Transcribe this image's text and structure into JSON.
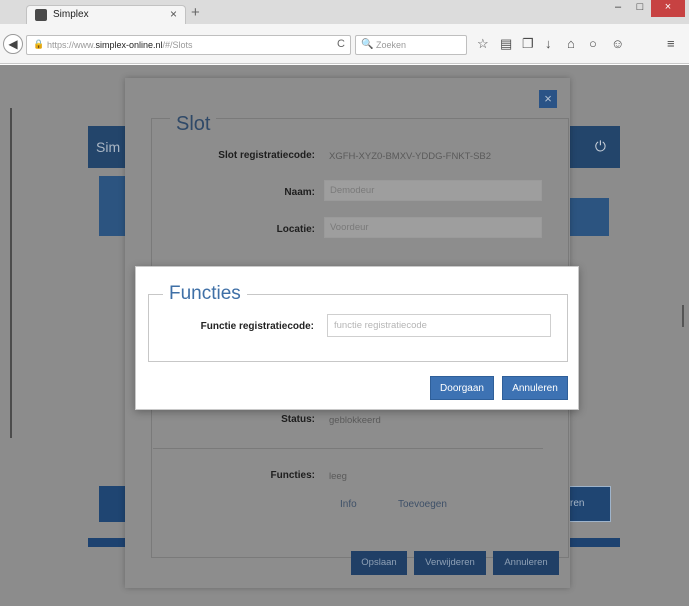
{
  "browser": {
    "tab_title": "Simplex",
    "tab_close": "×",
    "new_tab": "+",
    "window_buttons": {
      "minimize": "–",
      "maximize": "□",
      "close": "×"
    },
    "back": "◀",
    "url_prefix": "https://www.",
    "url_domain": "simplex-online.nl",
    "url_suffix": "/#/Slots",
    "reload": "C",
    "search_placeholder": "Zoeken",
    "toolbar_icons": {
      "bookmark": "☆",
      "library": "▤",
      "pocket": "❐",
      "download": "↓",
      "home": "⌂",
      "sync": "○",
      "extensions": "☺",
      "menu": "≡"
    }
  },
  "app": {
    "title": "Sim",
    "logout_icon": "⏻",
    "right_button_label": "ren"
  },
  "slot_modal": {
    "close": "×",
    "legend": "Slot",
    "fields": {
      "registratiecode_label": "Slot registratiecode:",
      "registratiecode_value": "XGFH-XYZ0-BMXV-YDDG-FNKT-SB2",
      "naam_label": "Naam:",
      "naam_value": "Demodeur",
      "locatie_label": "Locatie:",
      "locatie_value": "Voordeur",
      "status_label": "Status:",
      "status_value": "geblokkeerd",
      "functies_label": "Functies:",
      "functies_value": "leeg"
    },
    "links": {
      "info": "Info",
      "toevoegen": "Toevoegen"
    },
    "buttons": {
      "opslaan": "Opslaan",
      "verwijderen": "Verwijderen",
      "annuleren": "Annuleren"
    }
  },
  "functies_modal": {
    "legend": "Functies",
    "field_label": "Functie registratiecode:",
    "field_value": "",
    "field_placeholder": "functie registratiecode",
    "buttons": {
      "doorgaan": "Doorgaan",
      "annuleren": "Annuleren"
    }
  }
}
